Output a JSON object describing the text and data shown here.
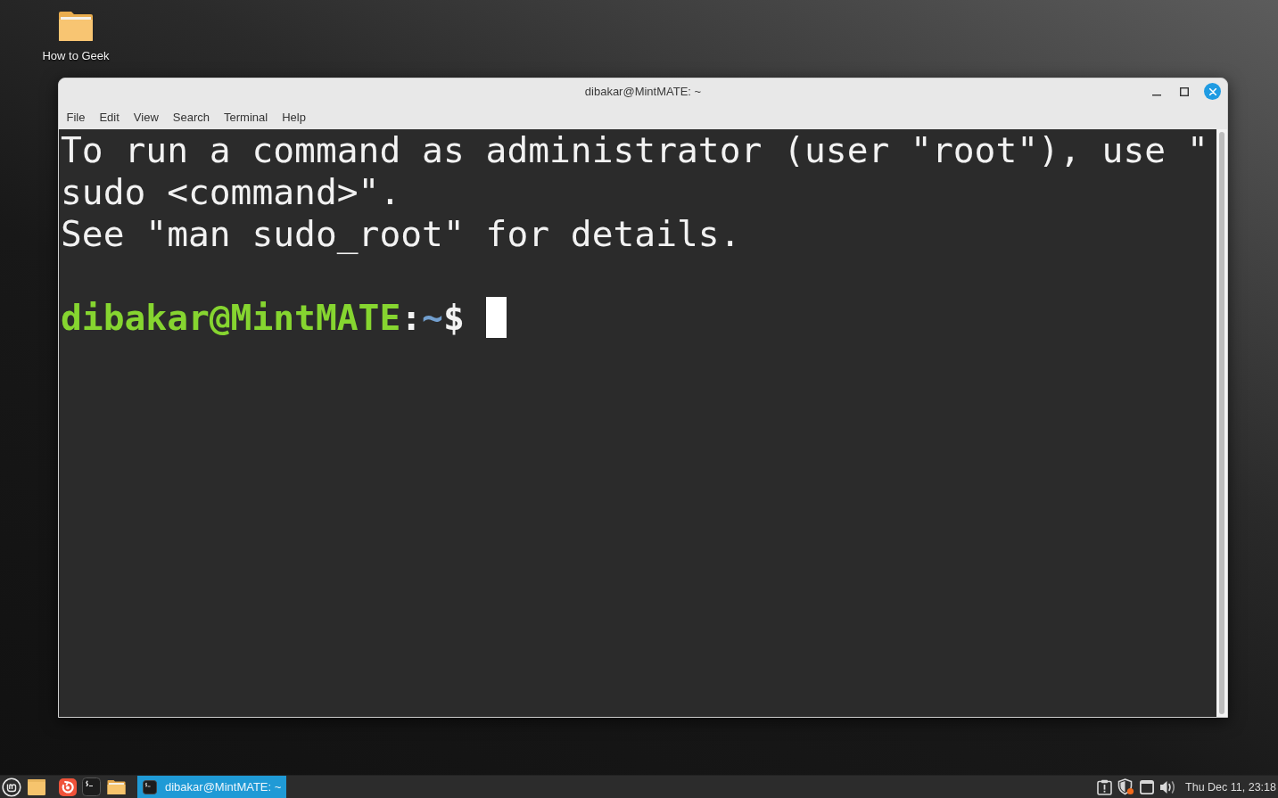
{
  "desktop": {
    "icons": [
      {
        "kind": "folder",
        "label": "How to Geek"
      }
    ]
  },
  "window": {
    "title": "dibakar@MintMATE: ~",
    "menu": [
      "File",
      "Edit",
      "View",
      "Search",
      "Terminal",
      "Help"
    ],
    "terminal": {
      "output": [
        "To run a command as administrator (user \"root\"), use \"",
        "sudo <command>\".",
        "See \"man sudo_root\" for details."
      ],
      "prompt": {
        "user_host": "dibakar@MintMATE",
        "separator": ":",
        "path": "~",
        "symbol": "$"
      }
    }
  },
  "taskbar": {
    "tasks": [
      {
        "label": "dibakar@MintMATE: ~",
        "selected": true
      }
    ],
    "clock": "Thu Dec 11, 23:18"
  }
}
